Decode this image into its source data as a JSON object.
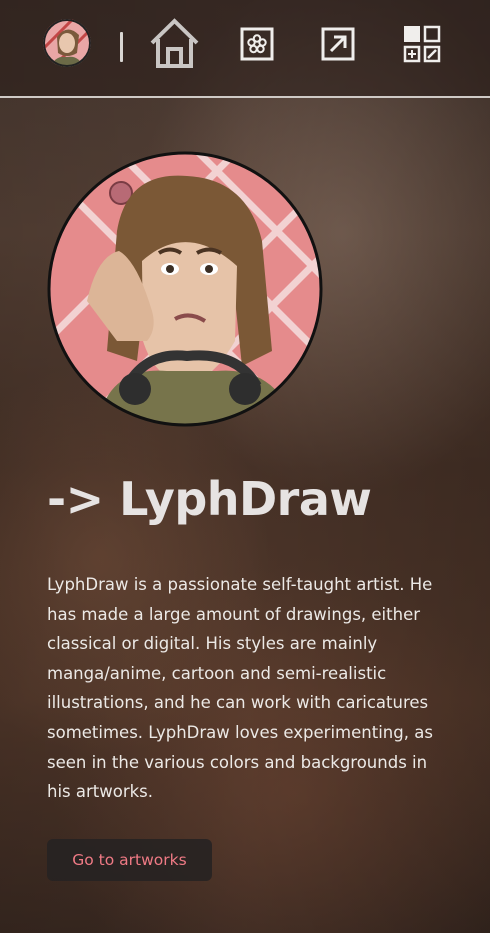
{
  "nav": {
    "avatar_alt": "LyphDraw avatar",
    "icons": [
      "home-icon",
      "flower-icon",
      "external-link-icon",
      "apps-grid-icon"
    ]
  },
  "hero": {
    "title": "-> LyphDraw",
    "description": "LyphDraw is a passionate self-taught artist. He has made a large amount of drawings, either classical or digital. His styles are mainly manga/anime, cartoon and semi-realistic illustrations, and he can work with caricatures sometimes. LyphDraw loves experimenting, as seen in the various colors and backgrounds in his artworks.",
    "cta_label": "Go to artworks"
  },
  "colors": {
    "accent": "#ef7a85",
    "portrait_bg": "#e58b8c",
    "button_bg": "#262222",
    "text": "#ece9e6"
  }
}
